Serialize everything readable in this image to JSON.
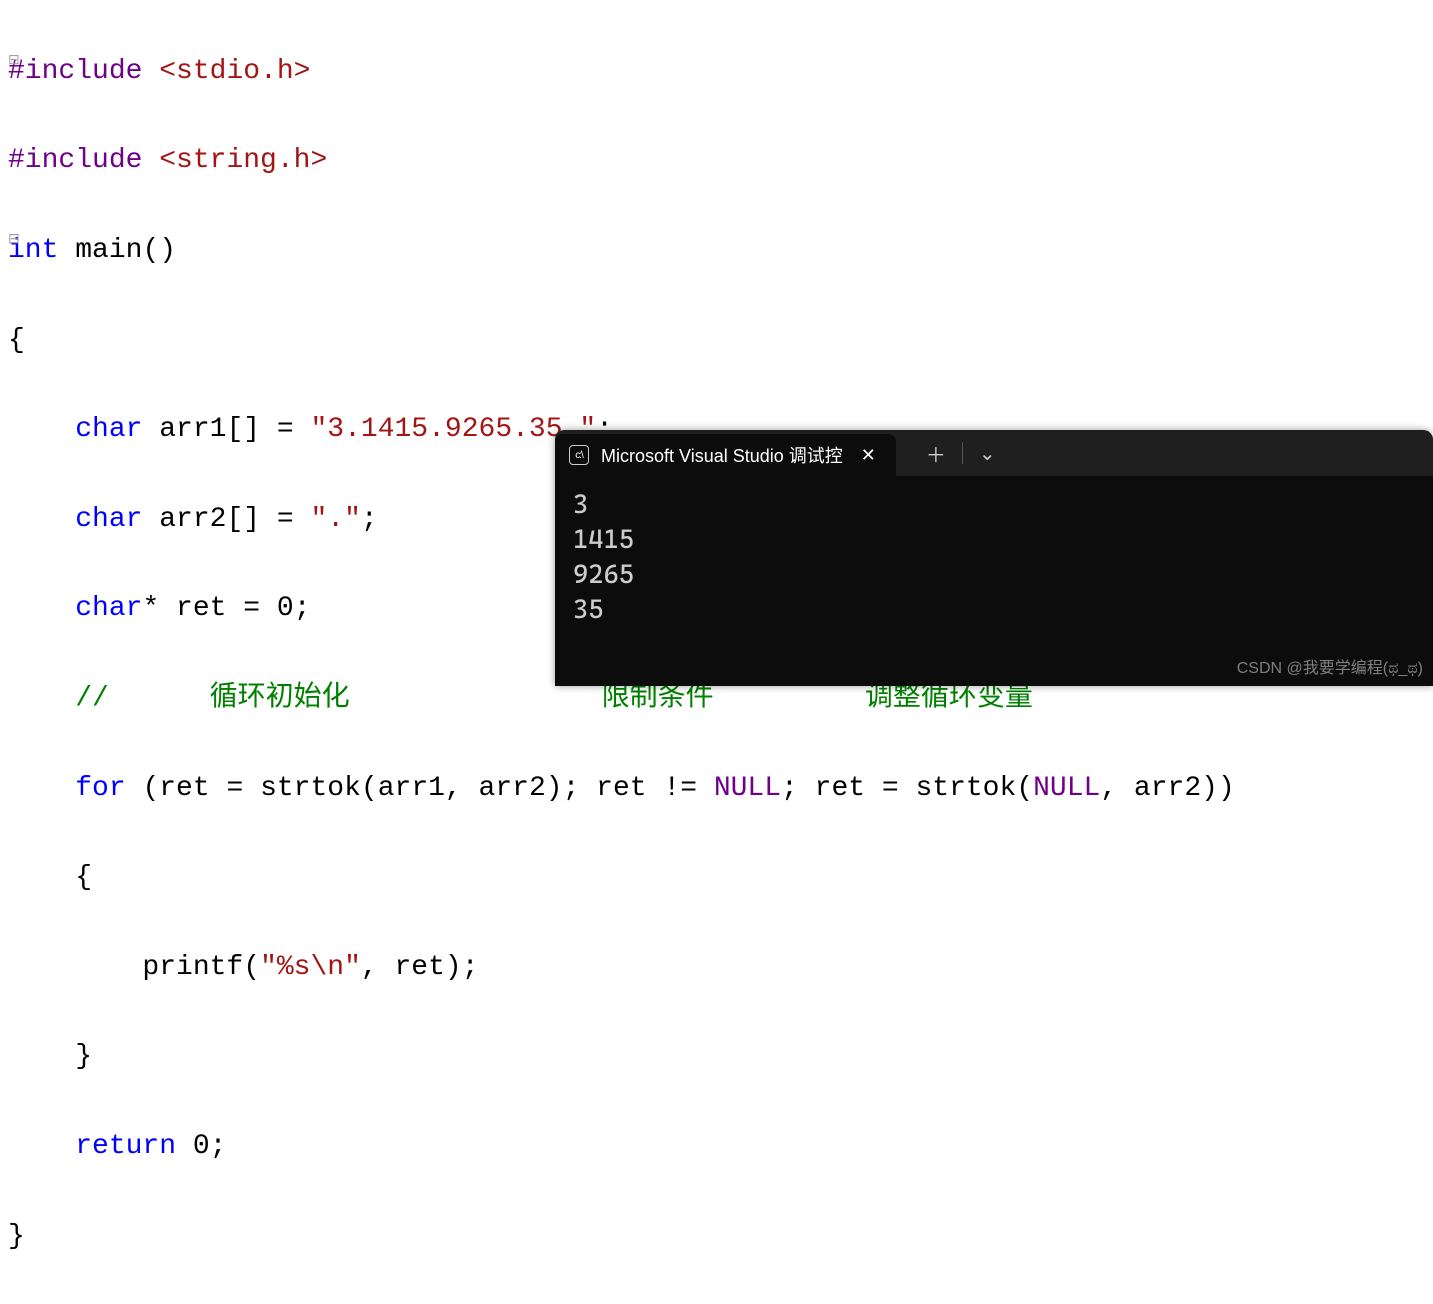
{
  "code": {
    "l1": {
      "pre": "#include ",
      "hdr": "<stdio.h>"
    },
    "l2": {
      "pre": "#include ",
      "hdr": "<string.h>"
    },
    "l3": {
      "t_int": "int",
      "main": " main",
      "parens": "()"
    },
    "l4": "{",
    "l5": {
      "indent": "    ",
      "t_char": "char",
      "name": " arr1",
      "brk": "[] ",
      "eq": "= ",
      "str": "\"3.1415.9265.35.\"",
      "semi": ";"
    },
    "l6": {
      "indent": "    ",
      "t_char": "char",
      "name": " arr2",
      "brk": "[] ",
      "eq": "= ",
      "str": "\".\"",
      "semi": ";"
    },
    "l7": {
      "indent": "    ",
      "t_char": "char",
      "star": "* ",
      "name": "ret ",
      "eq": "= ",
      "zero": "0",
      "semi": ";"
    },
    "l8": {
      "indent": "    ",
      "slashes": "//      ",
      "c1": "循环初始化               限制条件         调整循环变量"
    },
    "l9": {
      "indent": "    ",
      "for": "for",
      "open": " (",
      "a1": "ret ",
      "eq1": "= ",
      "fn1": "strtok",
      "args1_open": "(",
      "args1": "arr1, arr2",
      "args1_close": ")",
      "semi1": "; ",
      "a2": "ret ",
      "ne": "!= ",
      "null1": "NULL",
      "semi2": "; ",
      "a3": "ret ",
      "eq2": "= ",
      "fn2": "strtok",
      "args2_open": "(",
      "null2": "NULL",
      "comma": ", arr2",
      "args2_close": ")",
      "close": ")"
    },
    "l10": {
      "indent": "    ",
      "brace": "{"
    },
    "l11": {
      "indent": "        ",
      "fn": "printf",
      "open": "(",
      "str": "\"%s\\n\"",
      "comma": ", ret",
      "close": ")",
      "semi": ";"
    },
    "l12": {
      "indent": "    ",
      "brace": "}"
    },
    "l13": {
      "indent": "    ",
      "ret": "return",
      "sp": " ",
      "zero": "0",
      "semi": ";"
    },
    "l14": "}"
  },
  "console": {
    "tab_title": "Microsoft Visual Studio 调试控",
    "output": [
      "3",
      "1415",
      "9265",
      "35"
    ]
  },
  "watermark": "CSDN @我要学编程(ಥ_ಥ)"
}
